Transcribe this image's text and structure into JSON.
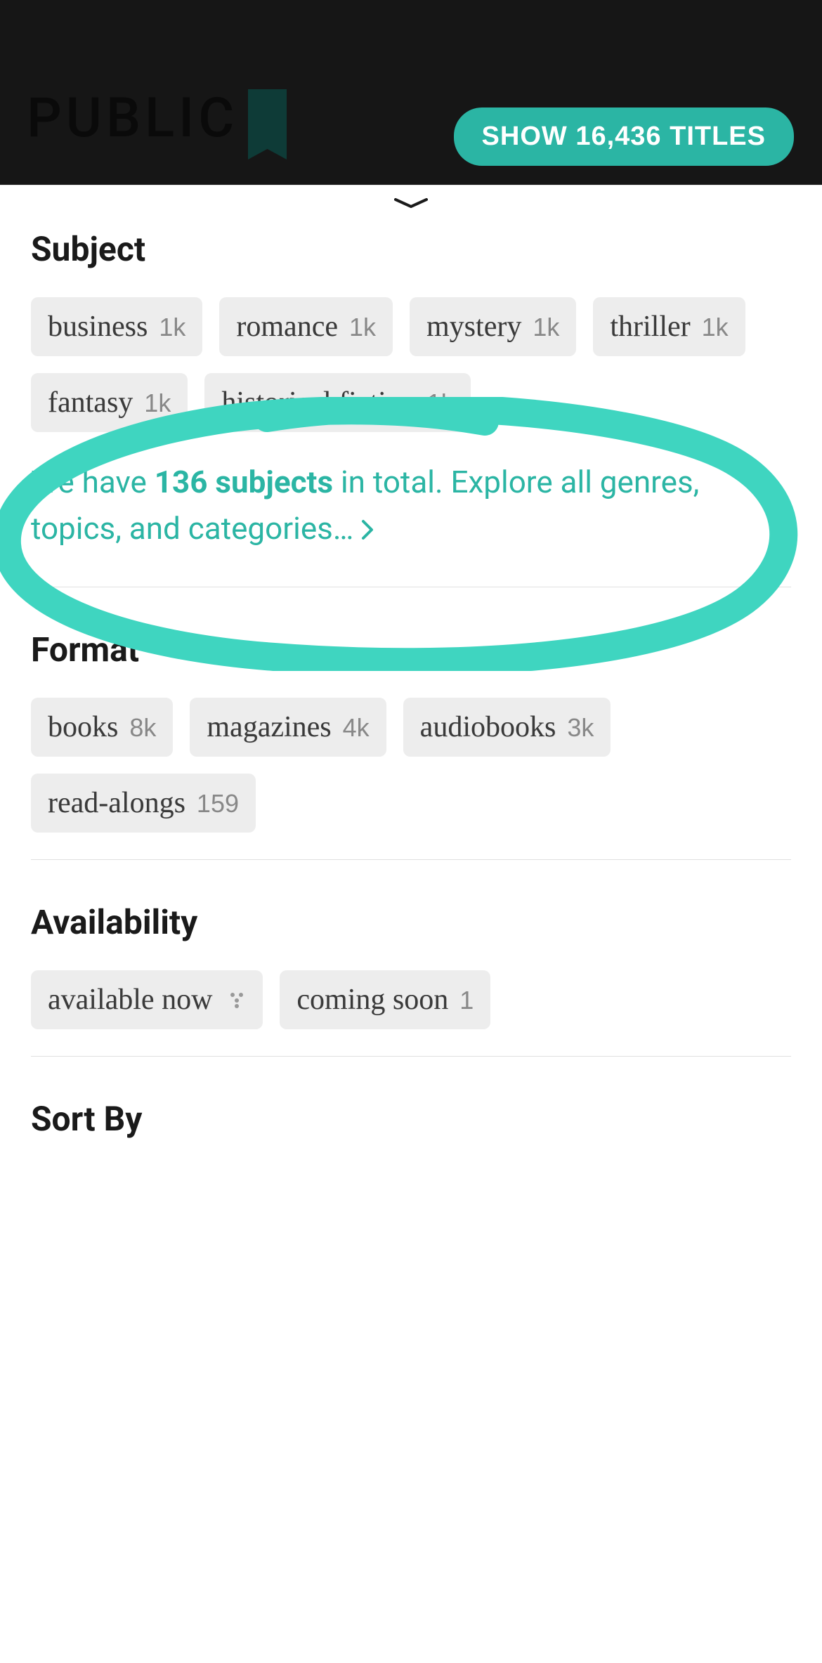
{
  "header": {
    "logo_line1": "PUBLIC",
    "show_button_label": "SHOW 16,436 TITLES"
  },
  "subject": {
    "title": "Subject",
    "chips": [
      {
        "label": "business",
        "count": "1k"
      },
      {
        "label": "romance",
        "count": "1k"
      },
      {
        "label": "mystery",
        "count": "1k"
      },
      {
        "label": "thriller",
        "count": "1k"
      },
      {
        "label": "fantasy",
        "count": "1k"
      },
      {
        "label": "historical fiction",
        "count": "1k"
      }
    ],
    "explore": {
      "prefix": "We have ",
      "bold": "136 subjects",
      "suffix": " in total. Explore all genres, topics, and categories… "
    }
  },
  "format": {
    "title": "Format",
    "chips": [
      {
        "label": "books",
        "count": "8k"
      },
      {
        "label": "magazines",
        "count": "4k"
      },
      {
        "label": "audiobooks",
        "count": "3k"
      },
      {
        "label": "read-alongs",
        "count": "159"
      }
    ]
  },
  "availability": {
    "title": "Availability",
    "chips": [
      {
        "label": "available now",
        "icon": "estimate"
      },
      {
        "label": "coming soon",
        "count": "1"
      }
    ]
  },
  "sortby": {
    "title": "Sort By"
  }
}
